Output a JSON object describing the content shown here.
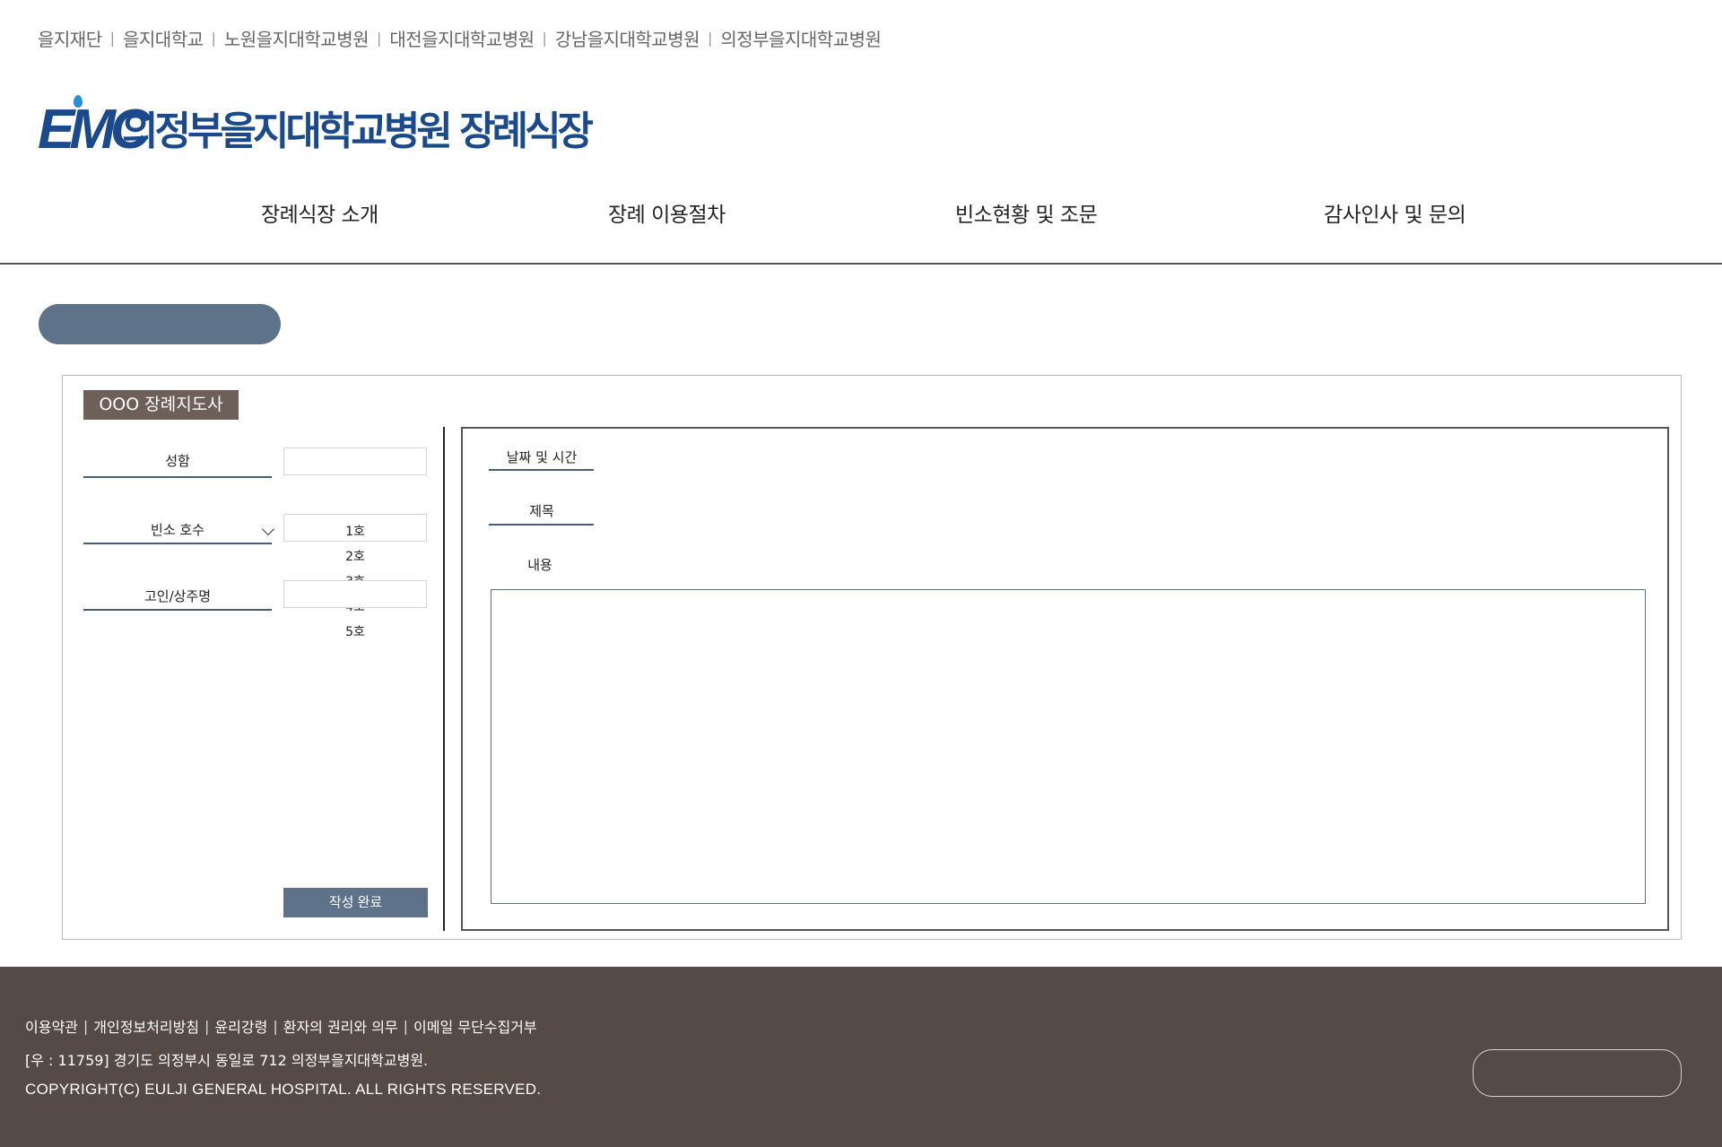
{
  "family_links": [
    "을지재단",
    "을지대학교",
    "노원을지대학교병원",
    "대전을지대학교병원",
    "강남을지대학교병원",
    "의정부을지대학교병원"
  ],
  "logo": {
    "mark": "EMC",
    "text": "의정부을지대학교병원 장례식장"
  },
  "nav": [
    "장례식장 소개",
    "장례 이용절차",
    "빈소현황 및 조문",
    "감사인사 및 문의"
  ],
  "form": {
    "director": "OOO 장례지도사",
    "name_label": "성함",
    "room_label": "빈소 호수",
    "deceased_label": "고인/상주명",
    "room_options": [
      "1호",
      "2호",
      "3호",
      "4호",
      "5호"
    ],
    "submit_label": "작성 완료"
  },
  "post": {
    "date_label": "날짜 및 시간",
    "title_label": "제목",
    "content_label": "내용"
  },
  "footer": {
    "links": [
      "이용약관",
      "개인정보처리방침",
      "윤리강령",
      "환자의 권리와 의무",
      "이메일 무단수집거부"
    ],
    "address": "[우 : 11759] 경기도 의정부시 동일로 712 의정부을지대학교병원.",
    "copyright": "COPYRIGHT(C) EULJI GENERAL HOSPITAL. ALL RIGHTS RESERVED."
  },
  "colors": {
    "brand_blue": "#1b4a8c",
    "accent_slate": "#5e738a",
    "director_tag": "#6e6058",
    "footer_bg": "#554a45"
  }
}
